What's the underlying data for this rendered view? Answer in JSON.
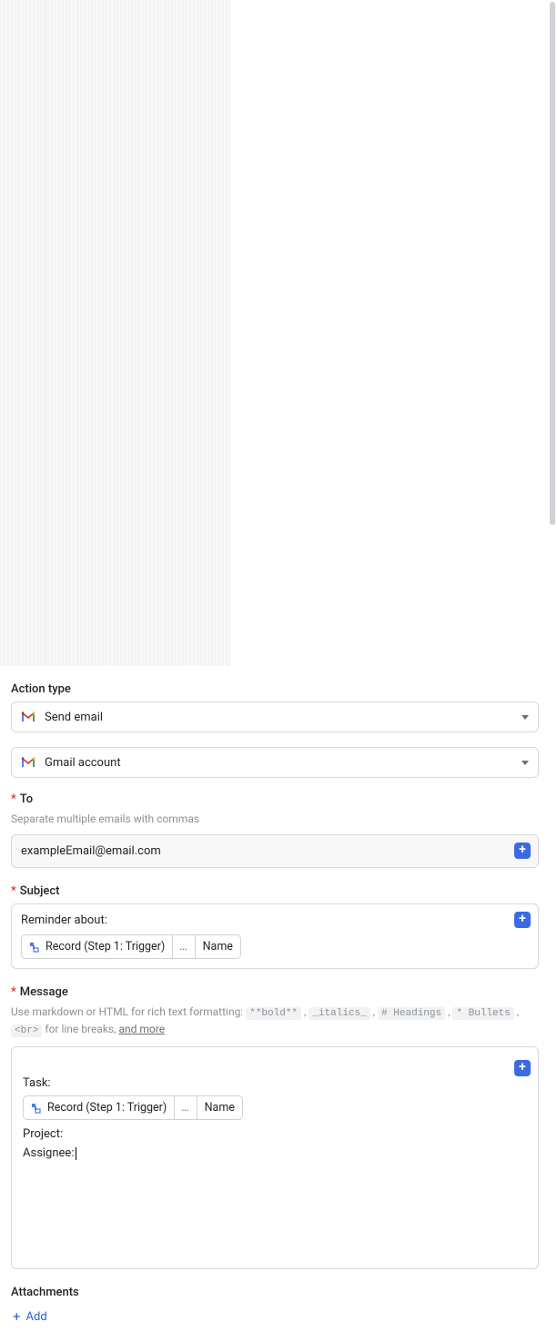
{
  "actionType": {
    "label": "Action type",
    "value": "Send email",
    "accountValue": "Gmail account"
  },
  "to": {
    "label": "To",
    "hint": "Separate multiple emails with commas",
    "value": "exampleEmail@email.com"
  },
  "subject": {
    "label": "Subject",
    "prefix": "Reminder about:",
    "record_label": "Record (Step 1: Trigger)",
    "dots": "…",
    "name_label": "Name"
  },
  "message": {
    "label": "Message",
    "hint_pre": "Use markdown or HTML for rich text formatting:",
    "hint_bold": "**bold**",
    "hint_italics": "_italics_",
    "hint_headings": "# Headings",
    "hint_bullets": "* Bullets",
    "hint_br": "<br>",
    "hint_br_after": "for line breaks,",
    "hint_more": "and more",
    "task_label": "Task:",
    "record_label": "Record (Step 1: Trigger)",
    "dots": "…",
    "name_label": "Name",
    "project_label": "Project:",
    "assignee_label": "Assignee:"
  },
  "attachments": {
    "label": "Attachments",
    "add": "Add"
  }
}
